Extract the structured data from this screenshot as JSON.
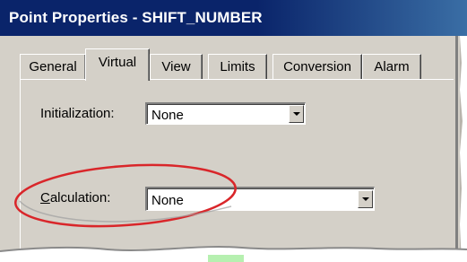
{
  "window": {
    "title": "Point Properties - SHIFT_NUMBER"
  },
  "tabs": [
    {
      "label": "General",
      "active": false
    },
    {
      "label": "Virtual",
      "active": true
    },
    {
      "label": "View",
      "active": false
    },
    {
      "label": "Limits",
      "active": false
    },
    {
      "label": "Conversion",
      "active": false
    },
    {
      "label": "Alarm",
      "active": false
    }
  ],
  "virtual": {
    "initialization": {
      "label": "Initialization:",
      "value": "None"
    },
    "calculation": {
      "label_mnemonic": "C",
      "label_rest": "alculation:",
      "value": "None"
    }
  },
  "colors": {
    "titlebar": "#0a246a",
    "face": "#d4d0c8",
    "highlight_ellipse": "#d9262a"
  }
}
